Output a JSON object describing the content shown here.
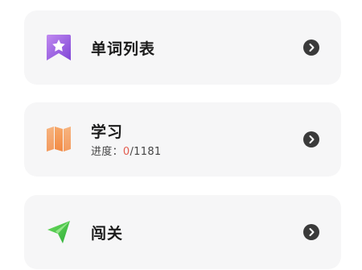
{
  "items": [
    {
      "title": "单词列表",
      "icon": "bookmark-star-icon",
      "color": "#9c5de0"
    },
    {
      "title": "学习",
      "icon": "map-icon",
      "color": "#f6a05c",
      "progress": {
        "label": "进度：",
        "current": "0",
        "separator": "/",
        "total": "1181"
      }
    },
    {
      "title": "闯关",
      "icon": "paper-plane-icon",
      "color": "#4cc94a"
    }
  ],
  "colors": {
    "card_bg": "#f6f6f7",
    "progress_current": "#e35b4e",
    "arrow": "#3a3a3a"
  }
}
